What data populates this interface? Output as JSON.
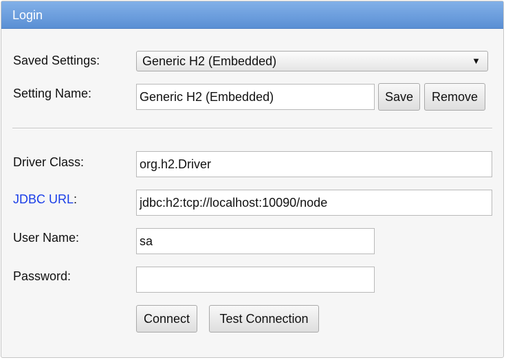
{
  "window": {
    "title": "Login"
  },
  "saved_settings": {
    "label": "Saved Settings:",
    "selected": "Generic H2 (Embedded)",
    "arrow": "▼"
  },
  "setting_name": {
    "label": "Setting Name:",
    "value": "Generic H2 (Embedded)",
    "save_label": "Save",
    "remove_label": "Remove"
  },
  "driver_class": {
    "label": "Driver Class:",
    "value": "org.h2.Driver"
  },
  "jdbc_url": {
    "label_link": "JDBC URL",
    "label_suffix": ":",
    "value": "jdbc:h2:tcp://localhost:10090/node"
  },
  "user_name": {
    "label": "User Name:",
    "value": "sa"
  },
  "password": {
    "label": "Password:",
    "value": ""
  },
  "actions": {
    "connect_label": "Connect",
    "test_label": "Test Connection"
  },
  "colors": {
    "title_bar": "#6b9ce0",
    "link": "#1a3ee8"
  }
}
